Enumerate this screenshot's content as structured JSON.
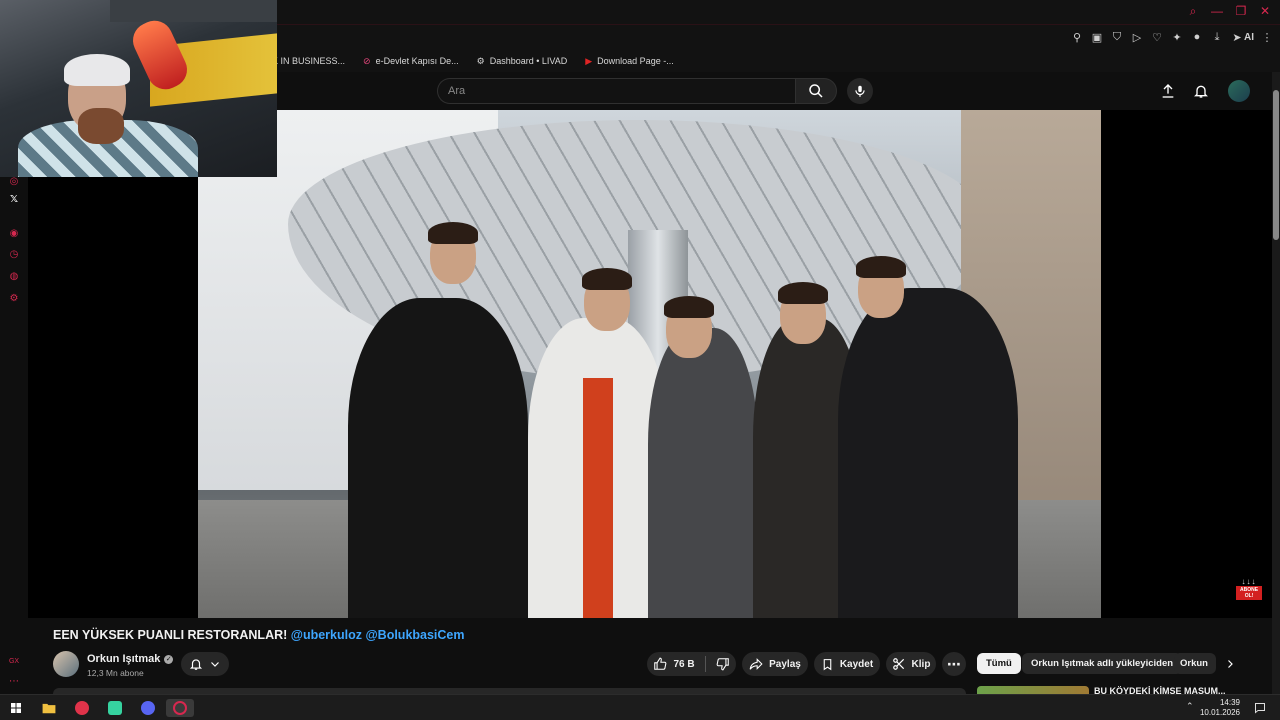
{
  "bookmarks": [
    {
      "label": "K IN BUSINESS...",
      "icon": "page-icon"
    },
    {
      "label": "e-Devlet Kapısı De...",
      "icon": "edevlet-icon"
    },
    {
      "label": "Dashboard • LIVAD",
      "icon": "dashboard-icon"
    },
    {
      "label": "Download Page -...",
      "icon": "youtube-icon"
    }
  ],
  "header": {
    "search_placeholder": "Ara"
  },
  "extensions": {
    "ai_label": "AI"
  },
  "video": {
    "title_main": "EEN YÜKSEK PUANLI RESTORANLAR! ",
    "title_tag1": "@uberkuloz",
    "title_tag2": "@BolukbasiCem",
    "subscribe_badge_arrows": "↓↓↓",
    "subscribe_badge_label": "ABONE OL!"
  },
  "channel": {
    "name": "Orkun Işıtmak",
    "subscribers": "12,3 Mn abone"
  },
  "actions": {
    "likes": "76 B",
    "share": "Paylaş",
    "save": "Kaydet",
    "clip": "Klip"
  },
  "chips": [
    {
      "label": "Tümü",
      "active": true
    },
    {
      "label": "Orkun Işıtmak adlı yükleyiciden",
      "active": false
    },
    {
      "label": "Orkun",
      "active": false
    }
  ],
  "recommendation": {
    "title": "BU KÖYDEKİ KİMSE MASUM..."
  },
  "taskbar": {
    "time": "14:39",
    "date": "10.01.2026"
  },
  "colors": {
    "accent": "#d6284f",
    "link": "#3ea6ff",
    "background": "#0f0f0f"
  }
}
